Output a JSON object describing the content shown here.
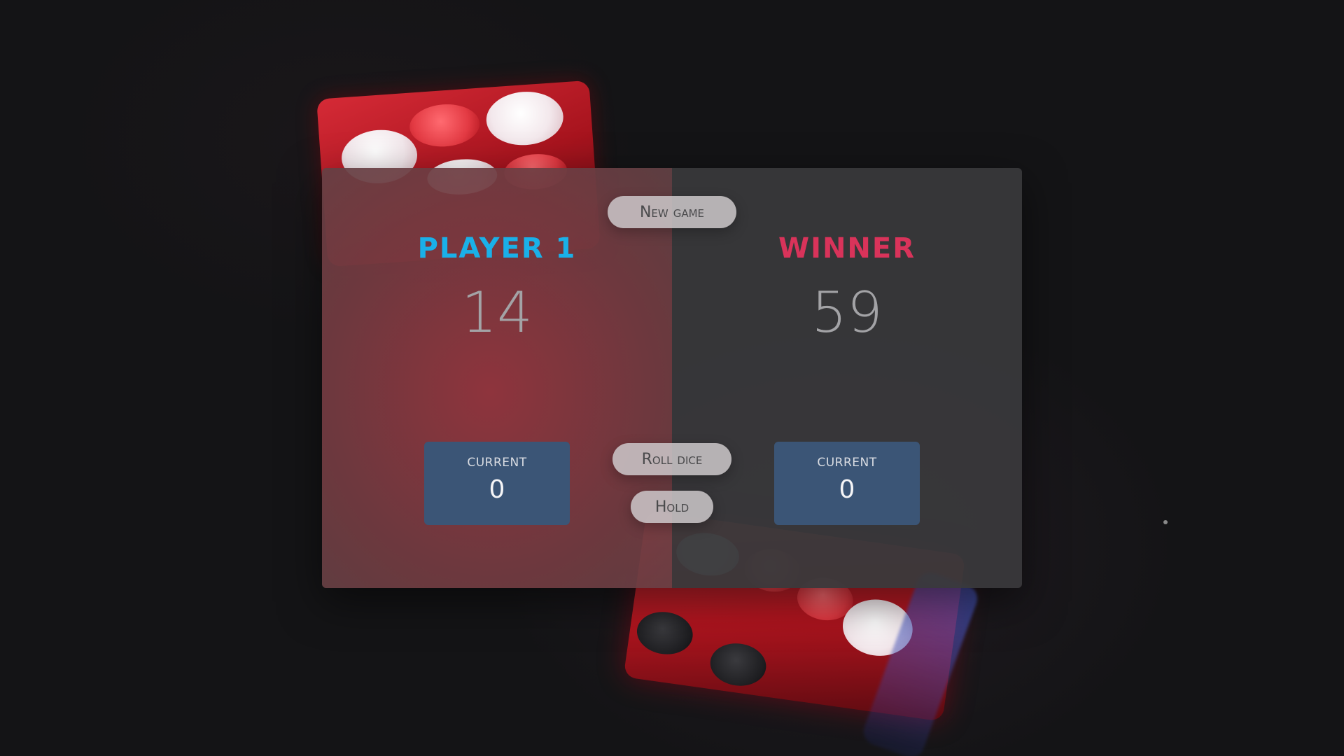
{
  "header": {
    "new_game_label": "New game"
  },
  "players": [
    {
      "name": "PLAYER 1",
      "score": "14",
      "current_label": "CURRENT",
      "current_score": "0",
      "active": true,
      "name_color": "#1ab0e8"
    },
    {
      "name": "WINNER",
      "score": "59",
      "current_label": "CURRENT",
      "current_score": "0",
      "active": false,
      "name_color": "#d9335a"
    }
  ],
  "controls": {
    "roll_label": "Roll dice",
    "hold_label": "Hold"
  },
  "colors": {
    "current_box": "#3b5576",
    "button_bg": "#cdc8ca",
    "score_text": "#a3a3a6"
  }
}
